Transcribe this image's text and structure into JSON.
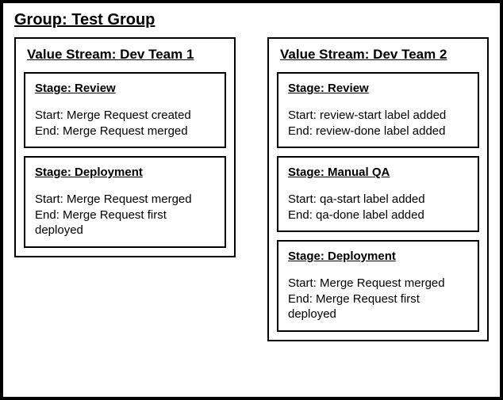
{
  "group": {
    "title": "Group: Test Group"
  },
  "streams": [
    {
      "title": "Value Stream: Dev Team 1",
      "stages": [
        {
          "title": "Stage: Review",
          "start": "Start: Merge Request created",
          "end": "End: Merge Request merged"
        },
        {
          "title": "Stage: Deployment",
          "start": "Start: Merge Request merged",
          "end": "End: Merge Request first deployed"
        }
      ]
    },
    {
      "title": "Value Stream: Dev Team 2",
      "stages": [
        {
          "title": "Stage: Review",
          "start": "Start: review-start label added",
          "end": "End: review-done label added"
        },
        {
          "title": "Stage: Manual QA",
          "start": "Start: qa-start label added",
          "end": "End: qa-done label added"
        },
        {
          "title": "Stage: Deployment",
          "start": "Start: Merge Request merged",
          "end": "End: Merge Request first deployed"
        }
      ]
    }
  ]
}
